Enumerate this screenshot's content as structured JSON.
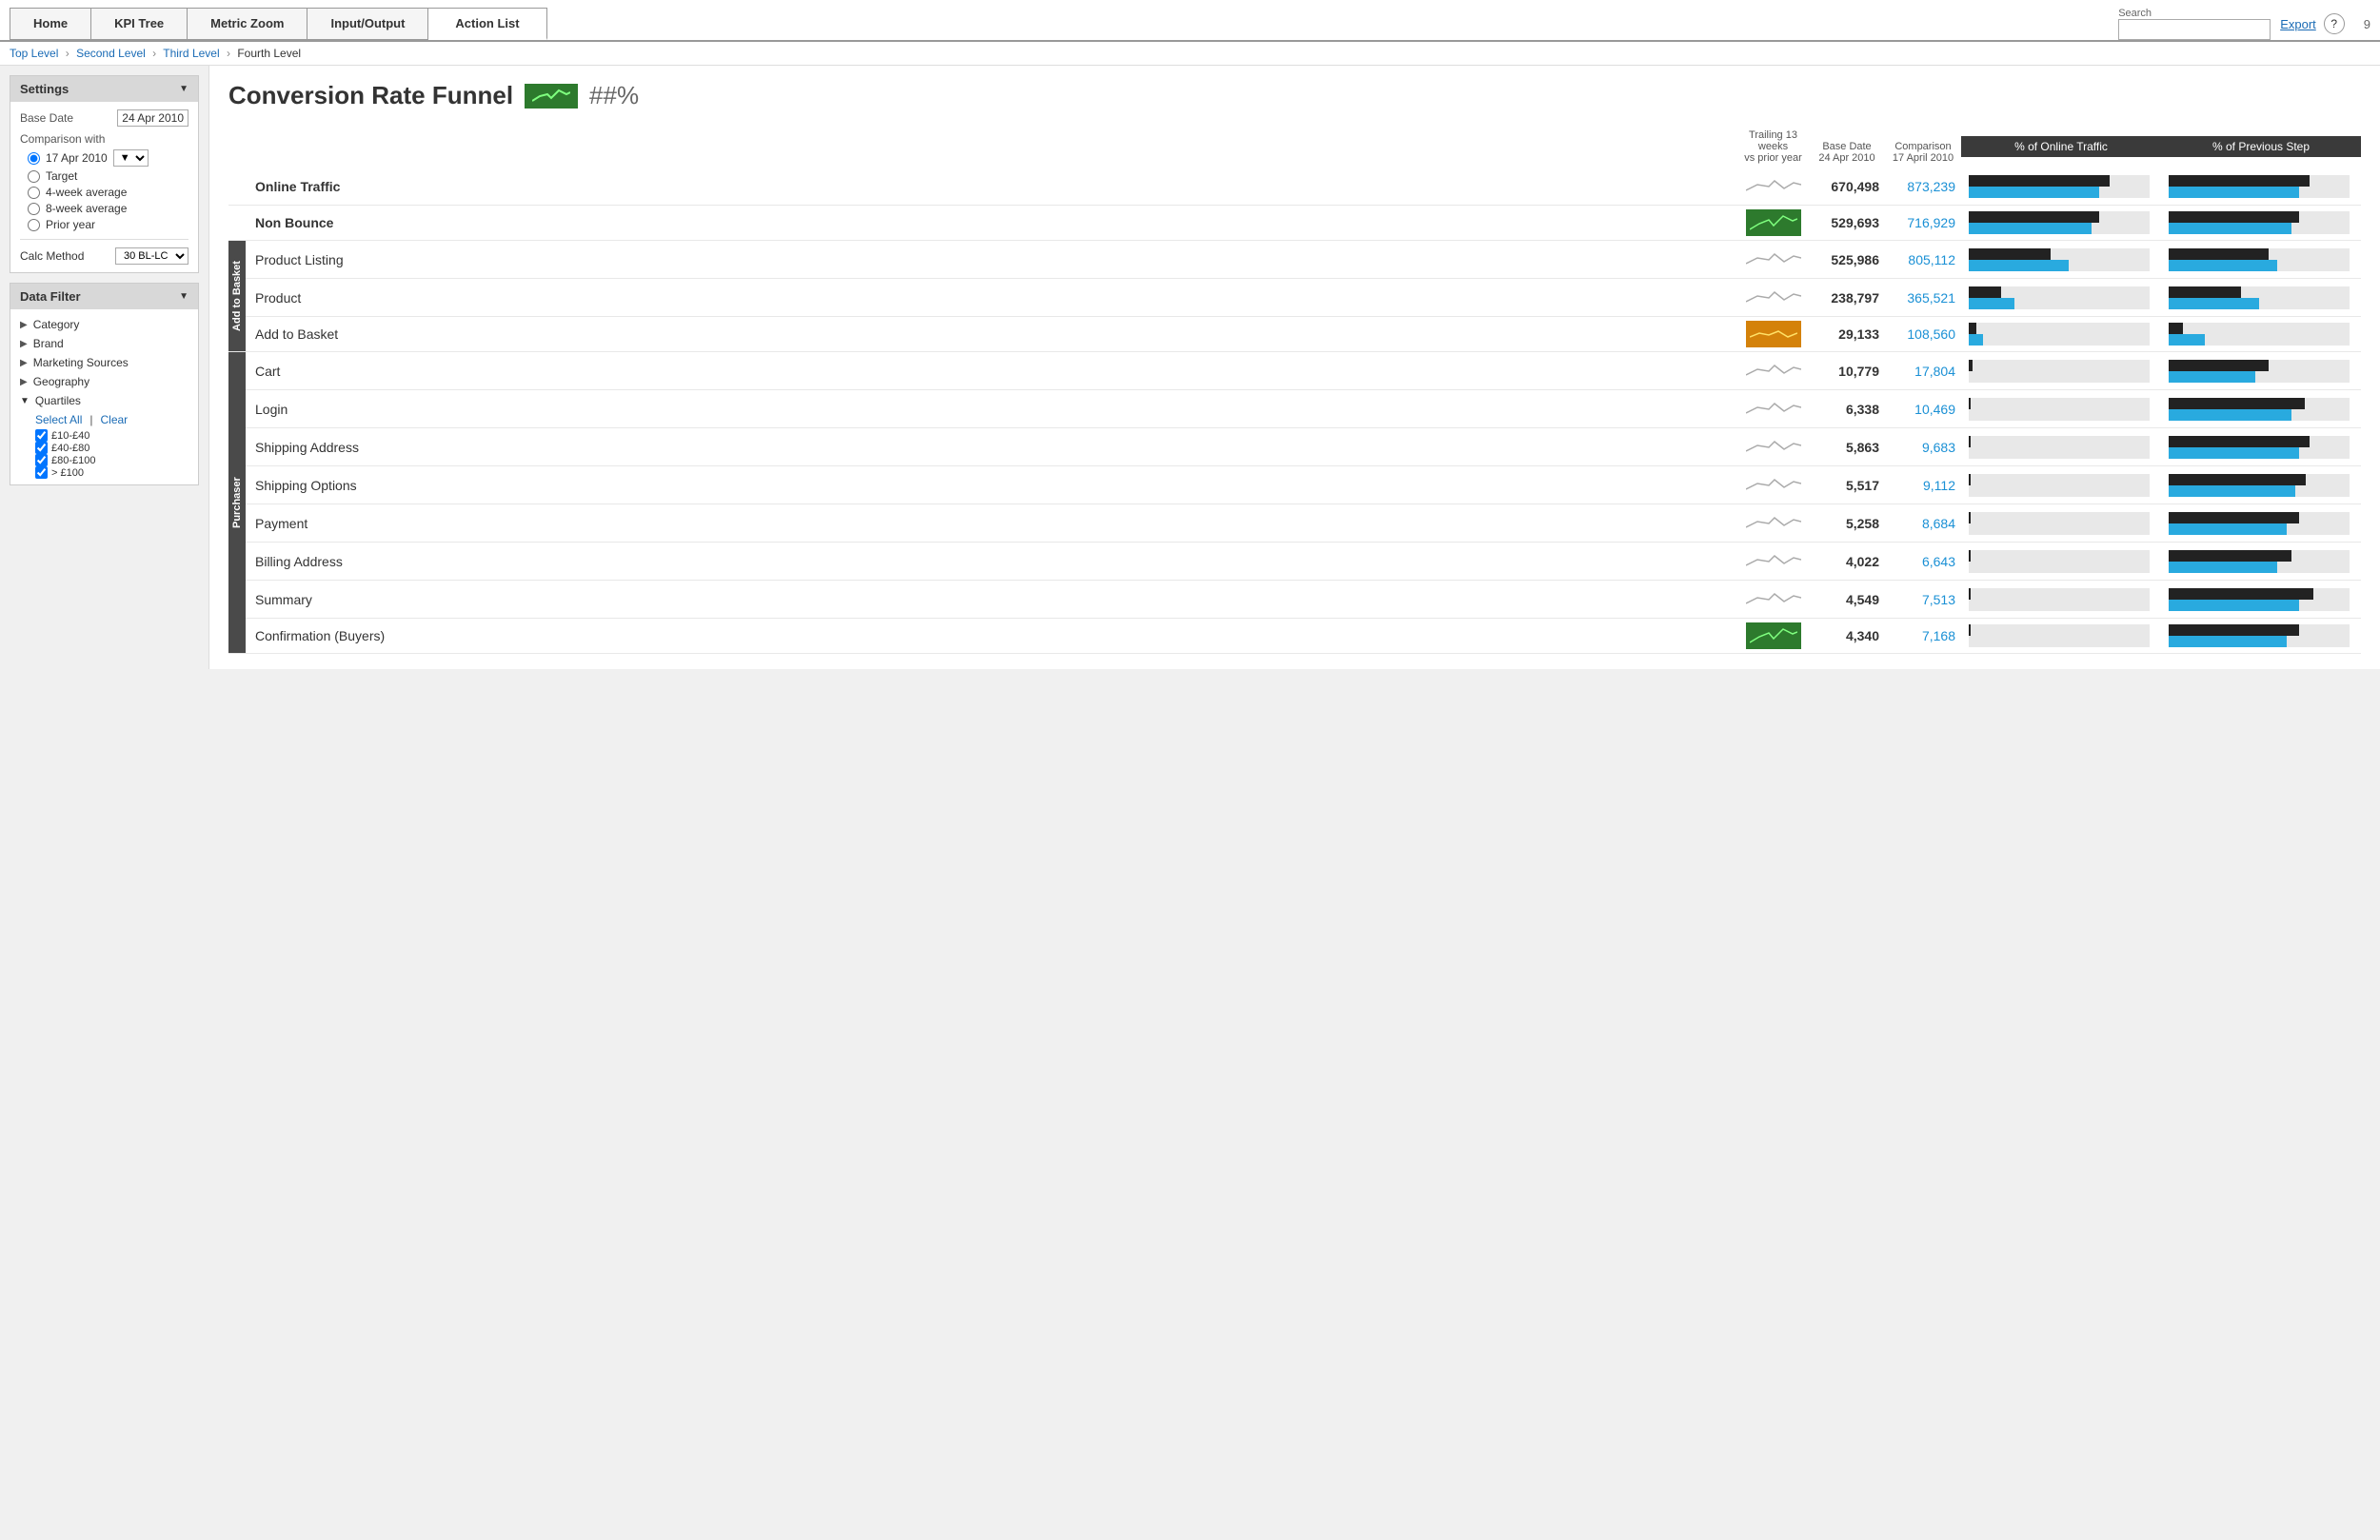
{
  "page": {
    "number": "9"
  },
  "nav": {
    "items": [
      "Home",
      "KPI Tree",
      "Metric Zoom",
      "Input/Output",
      "Action List"
    ],
    "active": "Action List",
    "search_label": "Search",
    "search_placeholder": "",
    "export_label": "Export",
    "help_label": "?"
  },
  "breadcrumb": {
    "items": [
      "Top Level",
      "Second Level",
      "Third Level",
      "Fourth Level"
    ]
  },
  "title": {
    "main": "Conversion Rate Funnel",
    "value": "##%"
  },
  "settings": {
    "header": "Settings",
    "base_date_label": "Base Date",
    "base_date_value": "24 Apr 2010",
    "comparison_label": "Comparison with",
    "radio_options": [
      {
        "label": "17 Apr 2010",
        "checked": true
      },
      {
        "label": "Target",
        "checked": false
      },
      {
        "label": "4-week average",
        "checked": false
      },
      {
        "label": "8-week average",
        "checked": false
      },
      {
        "label": "Prior year",
        "checked": false
      }
    ],
    "calc_label": "Calc Method",
    "calc_value": "30 BL-LC"
  },
  "data_filter": {
    "header": "Data Filter",
    "items": [
      {
        "label": "Category",
        "expandable": true,
        "expanded": false
      },
      {
        "label": "Brand",
        "expandable": true,
        "expanded": false
      },
      {
        "label": "Marketing Sources",
        "expandable": true,
        "expanded": false
      },
      {
        "label": "Geography",
        "expandable": true,
        "expanded": false
      },
      {
        "label": "Quartiles",
        "expandable": true,
        "expanded": true
      }
    ],
    "quartile_select_all": "Select All",
    "quartile_clear": "Clear",
    "quartile_items": [
      {
        "label": "£10-£40",
        "checked": true
      },
      {
        "label": "£40-£80",
        "checked": true
      },
      {
        "label": "£80-£100",
        "checked": true
      },
      {
        "label": "> £100",
        "checked": true
      }
    ]
  },
  "table": {
    "trailing_header": "Trailing 13 weeks",
    "vs_prior": "vs prior year",
    "base_date_header": "Base Date",
    "base_date_sub": "24 Apr 2010",
    "comparison_header": "Comparison",
    "comparison_sub": "17 April 2010",
    "col1_header": "% of Online Traffic",
    "col2_header": "% of Previous Step",
    "rows": [
      {
        "label": "Online Traffic",
        "bold": true,
        "section": "",
        "spark_type": "normal",
        "value": "670,498",
        "comparison": "873,239",
        "bar1_black": 78,
        "bar1_blue": 72,
        "bar2_black": 78,
        "bar2_blue": 72
      },
      {
        "label": "Non Bounce",
        "bold": true,
        "section": "",
        "spark_type": "green",
        "value": "529,693",
        "comparison": "716,929",
        "bar1_black": 72,
        "bar1_blue": 68,
        "bar2_black": 72,
        "bar2_blue": 68
      },
      {
        "label": "Product Listing",
        "bold": false,
        "section": "Add to Basket",
        "spark_type": "normal",
        "value": "525,986",
        "comparison": "805,112",
        "bar1_black": 45,
        "bar1_blue": 55,
        "bar2_black": 55,
        "bar2_blue": 60
      },
      {
        "label": "Product",
        "bold": false,
        "section": "",
        "spark_type": "normal",
        "value": "238,797",
        "comparison": "365,521",
        "bar1_black": 18,
        "bar1_blue": 25,
        "bar2_black": 40,
        "bar2_blue": 50
      },
      {
        "label": "Add to Basket",
        "bold": false,
        "section": "",
        "spark_type": "orange",
        "value": "29,133",
        "comparison": "108,560",
        "bar1_black": 4,
        "bar1_blue": 8,
        "bar2_black": 8,
        "bar2_blue": 20
      },
      {
        "label": "Cart",
        "bold": false,
        "section": "Purchaser",
        "spark_type": "normal",
        "value": "10,779",
        "comparison": "17,804",
        "bar1_black": 2,
        "bar1_blue": 0,
        "bar2_black": 55,
        "bar2_blue": 48
      },
      {
        "label": "Login",
        "bold": false,
        "section": "",
        "spark_type": "normal",
        "value": "6,338",
        "comparison": "10,469",
        "bar1_black": 1,
        "bar1_blue": 0,
        "bar2_black": 75,
        "bar2_blue": 68
      },
      {
        "label": "Shipping Address",
        "bold": false,
        "section": "",
        "spark_type": "normal",
        "value": "5,863",
        "comparison": "9,683",
        "bar1_black": 1,
        "bar1_blue": 0,
        "bar2_black": 78,
        "bar2_blue": 72
      },
      {
        "label": "Shipping Options",
        "bold": false,
        "section": "",
        "spark_type": "normal",
        "value": "5,517",
        "comparison": "9,112",
        "bar1_black": 1,
        "bar1_blue": 0,
        "bar2_black": 76,
        "bar2_blue": 70
      },
      {
        "label": "Payment",
        "bold": false,
        "section": "",
        "spark_type": "normal",
        "value": "5,258",
        "comparison": "8,684",
        "bar1_black": 1,
        "bar1_blue": 0,
        "bar2_black": 72,
        "bar2_blue": 65
      },
      {
        "label": "Billing Address",
        "bold": false,
        "section": "",
        "spark_type": "normal",
        "value": "4,022",
        "comparison": "6,643",
        "bar1_black": 1,
        "bar1_blue": 0,
        "bar2_black": 68,
        "bar2_blue": 60
      },
      {
        "label": "Summary",
        "bold": false,
        "section": "",
        "spark_type": "normal",
        "value": "4,549",
        "comparison": "7,513",
        "bar1_black": 1,
        "bar1_blue": 0,
        "bar2_black": 80,
        "bar2_blue": 72
      },
      {
        "label": "Confirmation (Buyers)",
        "bold": false,
        "section": "",
        "spark_type": "green",
        "value": "4,340",
        "comparison": "7,168",
        "bar1_black": 1,
        "bar1_blue": 0,
        "bar2_black": 72,
        "bar2_blue": 65
      }
    ]
  }
}
